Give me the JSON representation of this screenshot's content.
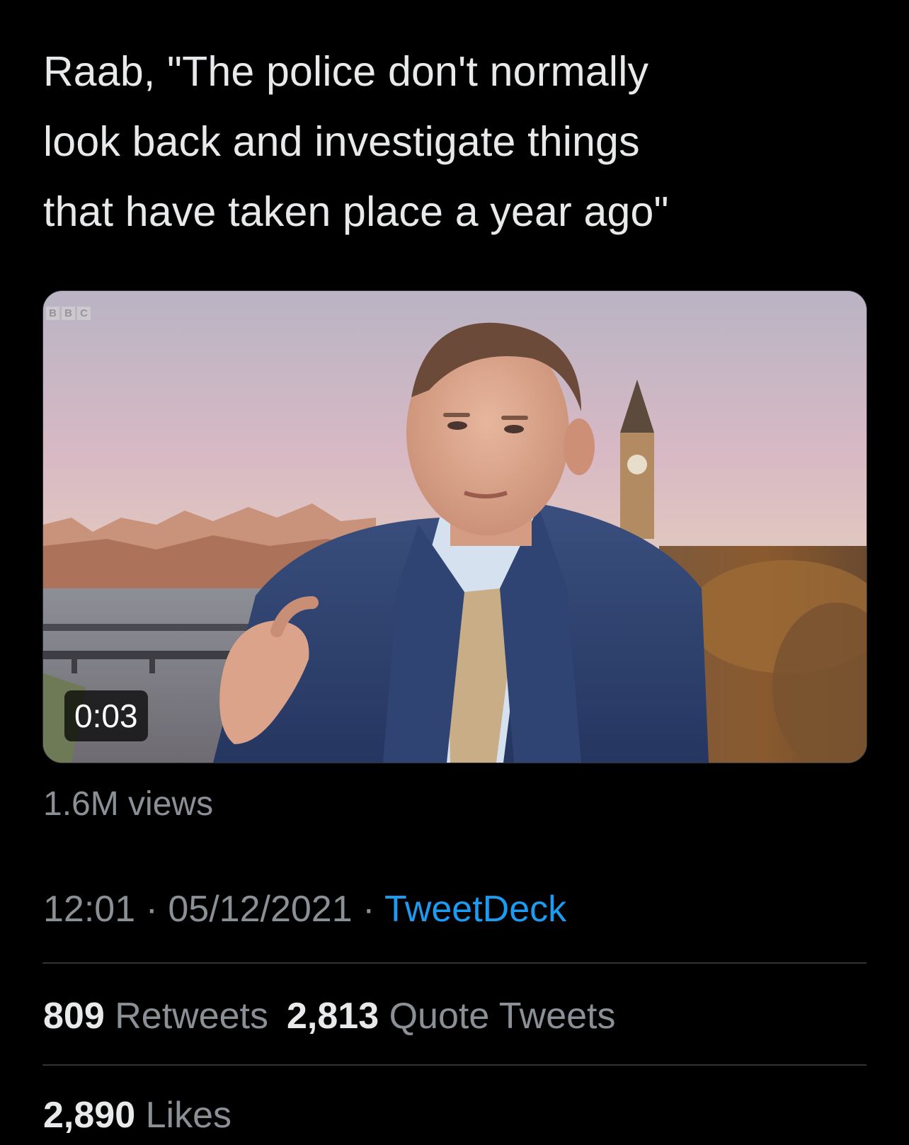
{
  "tweet": {
    "text": "Raab, \"The police don't normally\nlook back and investigate things\nthat have taken place a year ago\"",
    "media": {
      "logo_text": [
        "B",
        "B",
        "C"
      ],
      "duration": "0:03"
    },
    "views": "1.6M views",
    "time": "12:01",
    "separator": "·",
    "date": "05/12/2021",
    "source": "TweetDeck",
    "retweets": {
      "count": "809",
      "label": "Retweets"
    },
    "quote_tweets": {
      "count": "2,813",
      "label": "Quote Tweets"
    },
    "likes": {
      "count": "2,890",
      "label": "Likes"
    }
  },
  "colors": {
    "background": "#000000",
    "text": "#e7e9ea",
    "secondary": "#8b9096",
    "link": "#1d9bf0",
    "divider": "#2f3336"
  }
}
